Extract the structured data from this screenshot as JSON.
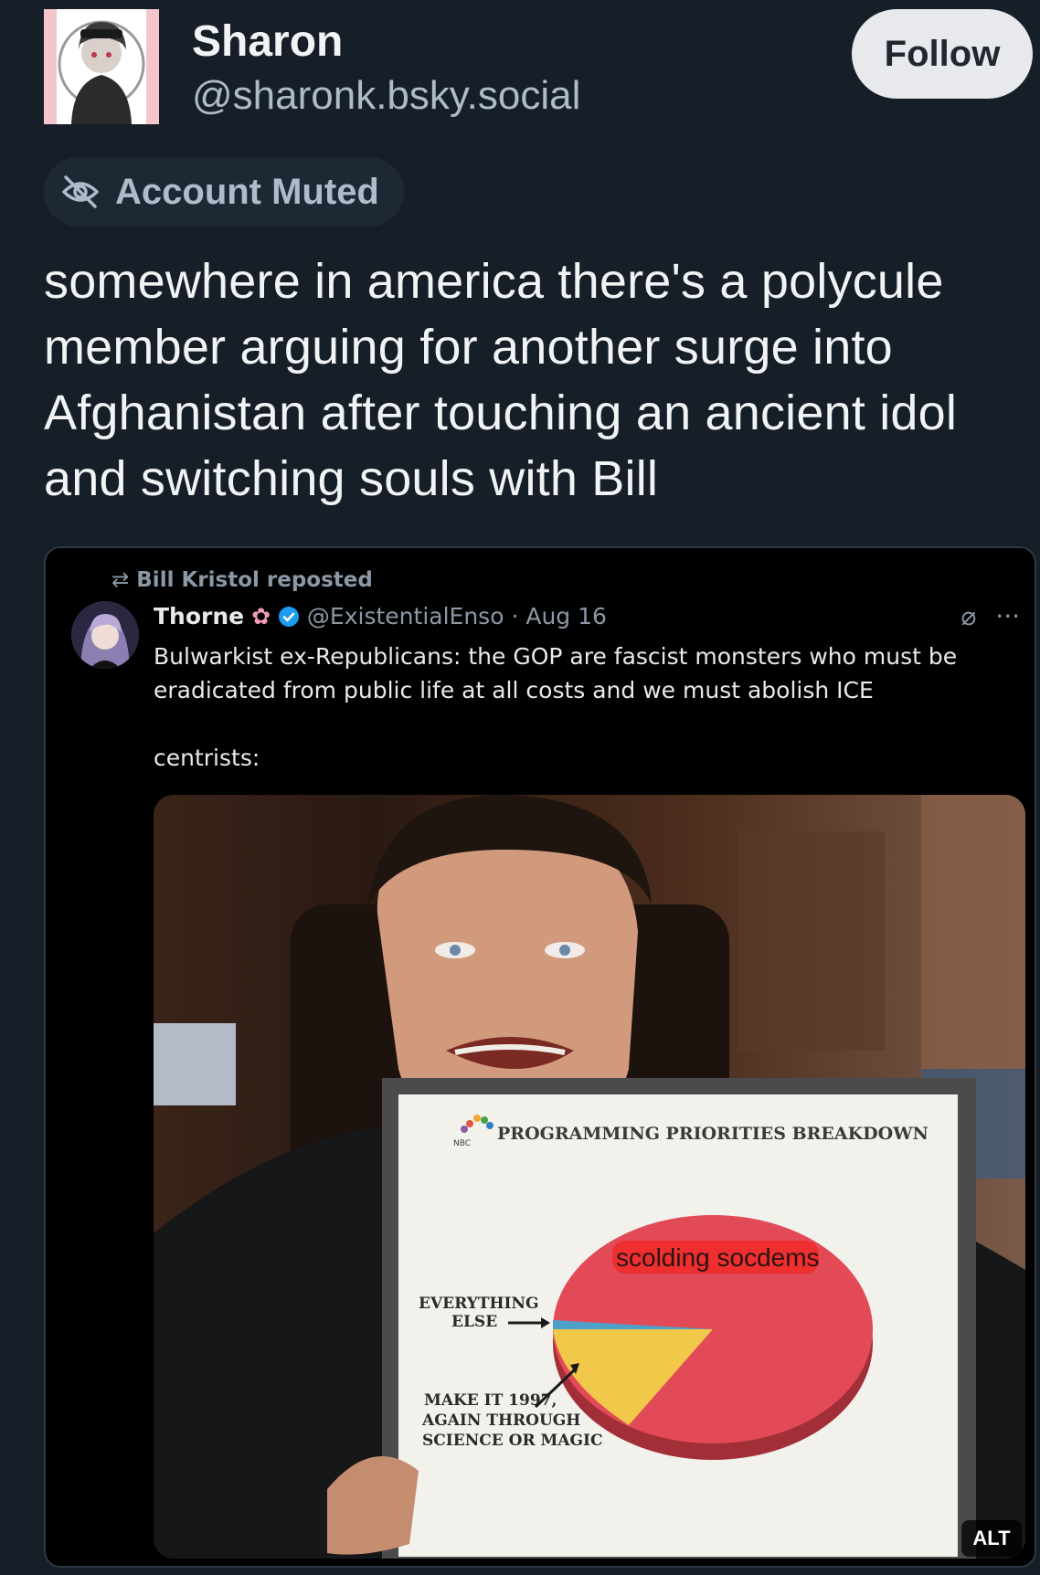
{
  "author": {
    "display_name": "Sharon",
    "handle": "@sharonk.bsky.social",
    "follow_label": "Follow"
  },
  "muted": {
    "label": "Account Muted",
    "icon": "eye-slash-icon"
  },
  "post": {
    "text": "somewhere in america there's a polycule\nmember arguing for another surge into\nAfghanistan after touching an ancient idol\nand switching souls with Bill"
  },
  "embed": {
    "repost_label": "Bill Kristol reposted",
    "author_name": "Thorne",
    "author_handle": "@ExistentialEnso",
    "date": "Aug 16",
    "body": "Bulwarkist ex-Republicans: the GOP are fascist monsters who must be\neradicated from public life at all costs and we must abolish ICE\n\ncentrists:",
    "chart_title": "PROGRAMMING PRIORITIES BREAKDOWN",
    "chart_logo": "NBC",
    "slice_big_label": "scolding socdems",
    "slice_small_label_1": "EVERYTHING",
    "slice_small_label_2": "ELSE",
    "slice_mid_label_1": "MAKE IT 1997,",
    "slice_mid_label_2": "AGAIN THROUGH",
    "slice_mid_label_3": "SCIENCE OR MAGIC",
    "alt_label": "ALT",
    "colors": {
      "big_slice": "#e14a56",
      "mid_slice": "#f2c84b",
      "verified": "#1d9bf0"
    }
  }
}
